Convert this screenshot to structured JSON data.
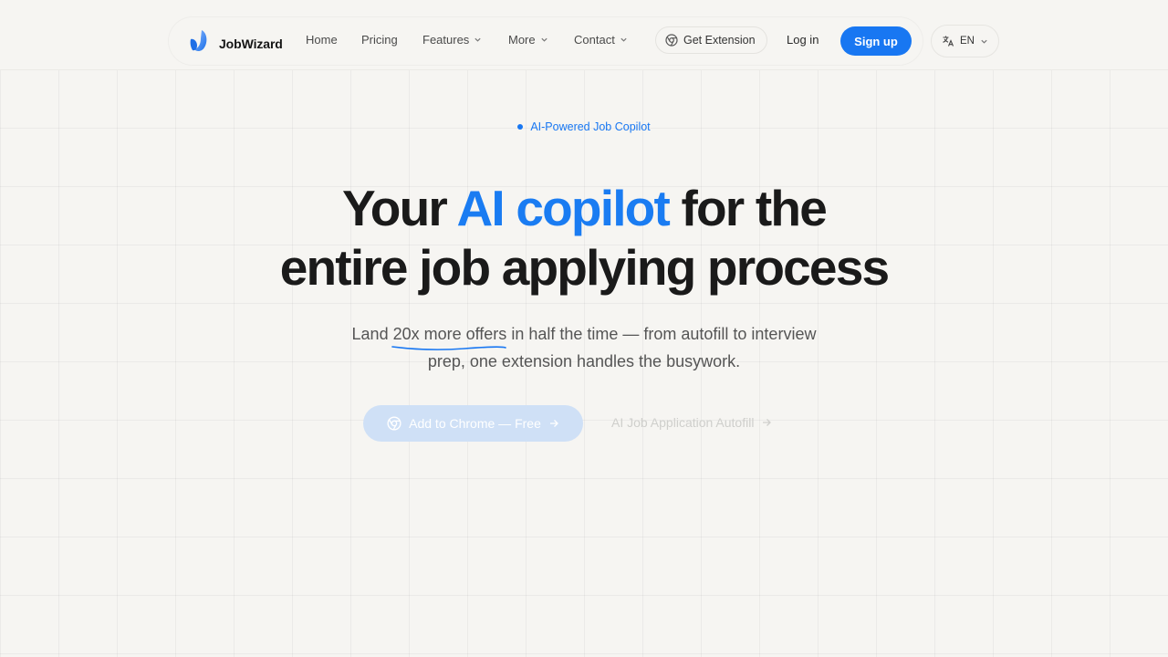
{
  "brand": {
    "name": "JobWizard",
    "logo_icon": "leaf-logo-icon"
  },
  "nav": {
    "items": [
      {
        "label": "Home",
        "has_dropdown": false
      },
      {
        "label": "Pricing",
        "has_dropdown": false
      },
      {
        "label": "Features",
        "has_dropdown": true
      },
      {
        "label": "More",
        "has_dropdown": true
      },
      {
        "label": "Contact",
        "has_dropdown": true
      }
    ],
    "extension_label": "Get Extension",
    "extension_icon": "chrome-icon",
    "login_label": "Log in",
    "signup_label": "Sign up"
  },
  "language": {
    "code": "EN",
    "icon": "translate-icon"
  },
  "hero": {
    "badge": "AI-Powered Job Copilot",
    "headline_part1": "Your ",
    "headline_accent": "AI copilot",
    "headline_part2": " for the",
    "headline_line2": "entire job applying process",
    "sub_before": "Land ",
    "sub_highlight": "20x more offers",
    "sub_after_line1": " in half the time — from autofill to interview",
    "sub_line2": "prep, one extension handles the busywork.",
    "cta_primary": "Add to Chrome — Free",
    "cta_secondary": "AI Job Application Autofill"
  },
  "colors": {
    "accent": "#1877f2",
    "background": "#f6f5f2",
    "text": "#1a1a1a",
    "cta_disabled": "#cfe0f6"
  }
}
